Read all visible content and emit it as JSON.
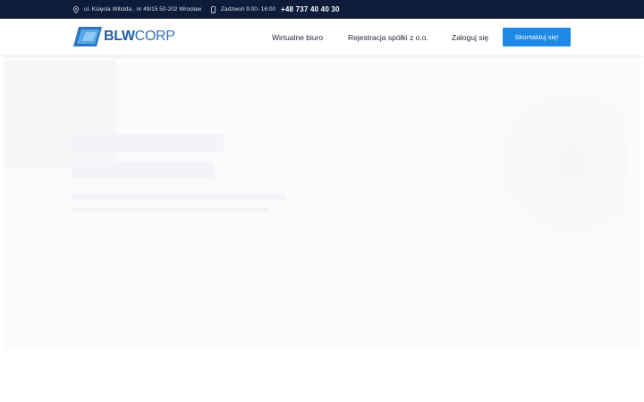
{
  "topbar": {
    "address": "ul. Księcia Witolda , nr 49/15 50-202 Wrocław",
    "hours": "Zadzwoń 9:00- 16:00",
    "phone": "+48 737 40 40 30"
  },
  "header": {
    "logo": {
      "bold": "BLW",
      "light": "CORP"
    },
    "nav": [
      {
        "label": "Wirtualne biuro"
      },
      {
        "label": "Rejestracja spółki z o.o."
      },
      {
        "label": "Zaloguj się"
      }
    ],
    "cta_label": "Skontaktuj się!"
  },
  "colors": {
    "topbar": "#0e1c3c",
    "accent": "#1e88e5",
    "logo": "#2f74c0"
  }
}
